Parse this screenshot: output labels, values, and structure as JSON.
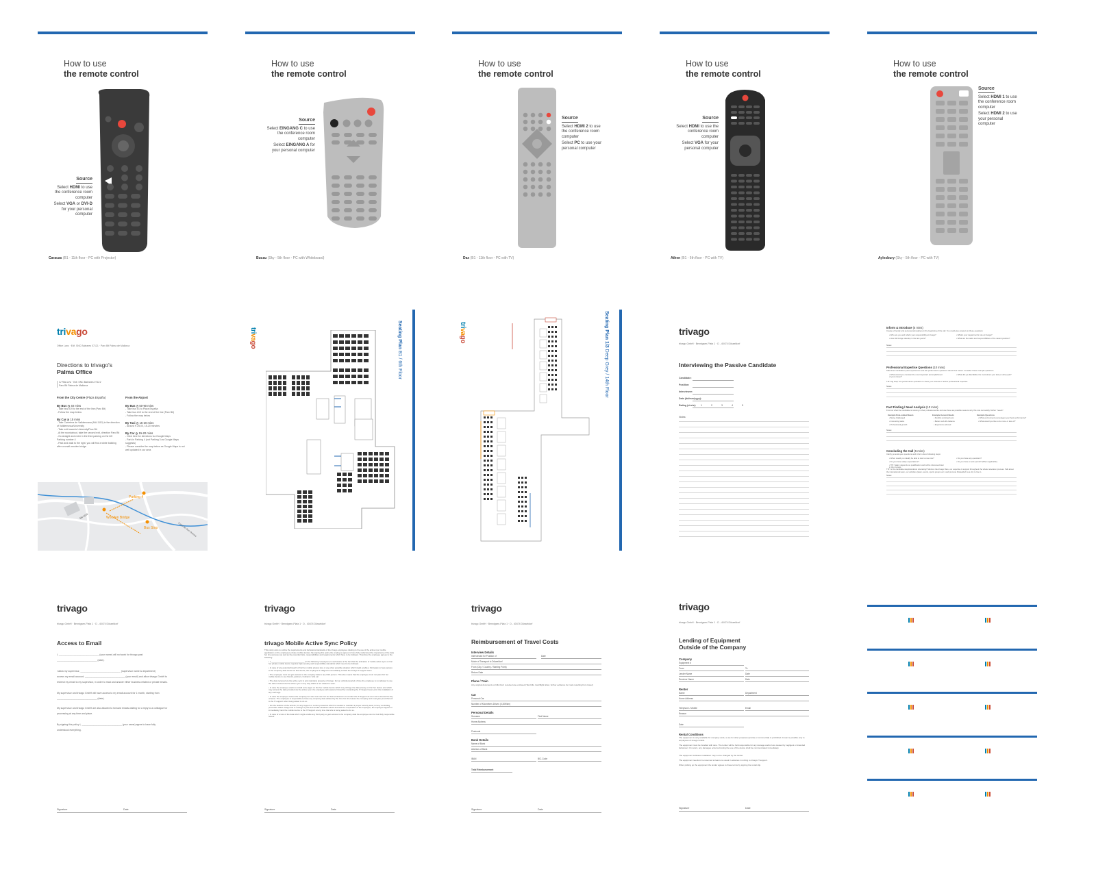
{
  "colors": {
    "blue": "#2267b0",
    "red": "#e8473c",
    "dark": "#3a3a3a",
    "gray": "#bdbdbd",
    "orange": "#f48f00",
    "teal": "#007fad"
  },
  "remote_title": {
    "line1": "How to use",
    "line2": "the remote control"
  },
  "remotes": [
    {
      "room": "Caracas",
      "floor": "(B1 - 11th floor - PC with Projector)",
      "source": "Source",
      "l1": "Select",
      "b1": "HDMI",
      "l2": "to use the conference room computer",
      "l3": "Select",
      "b2": "VGA",
      "l4": "or",
      "b3": "DVI-D",
      "l5": "for your personal computer"
    },
    {
      "room": "Bucau",
      "floor": "(Sky - 5th floor - PC with Whiteboard)",
      "source": "Source",
      "l1": "Select",
      "b1": "EINGANG C",
      "l2": "to use the conference room computer",
      "l3": "Select",
      "b2": "EINGANG A",
      "l4": "for your",
      "b3": "",
      "l5": "personal computer"
    },
    {
      "room": "Dax",
      "floor": "(B1 - 11th floor - PC with TV)",
      "source": "Source",
      "l1": "Select",
      "b1": "HDMI 2",
      "l2": "to use the conference room computer",
      "l3": "Select",
      "b2": "PC",
      "l4": "to use",
      "b3": "",
      "l5": "your personal computer"
    },
    {
      "room": "Athen",
      "floor": "(B1 - 6th floor - PC with TV)",
      "source": "Source",
      "l1": "Select",
      "b1": "HDMI",
      "l2": "to use the conference room computer",
      "l3": "Select",
      "b2": "VGA",
      "l4": "for your",
      "b3": "",
      "l5": "personal computer"
    },
    {
      "room": "Aylesbury",
      "floor": "(Sky - 5th floor - PC with TV)",
      "source": "Source",
      "l1": "Select",
      "b1": "HDMI 1",
      "l2": "to use the conference room computer",
      "l3": "Select",
      "b2": "HDMI 2",
      "l4": "to use your",
      "b3": "",
      "l5": "personal computer"
    }
  ],
  "brand": {
    "logo_a": "tri",
    "logo_b": "va",
    "logo_c": "go",
    "logo": "trivago"
  },
  "palma": {
    "address_top": "Office Lanc · Edf. SNC Baleares 07121 · Parc Bit Palma de Mallorca",
    "title1": "Directions to trivago's",
    "title2": "Palma Office",
    "addr_block": "C/ Rita Levi · Edf. SNC Baleares 07121 · Parc Bit Palma de Mallorca",
    "left_head": "From the City Centre",
    "left_head2": "(Plaza España)",
    "right_head": "From the Airport",
    "bus": "By Bus",
    "bus_time": "40 mins",
    "car": "By Car",
    "car_time": "15 mins",
    "taxi": "By Taxi",
    "taxi_time": "15-20 mins",
    "car2_time": "15-20 mins",
    "bus2_time": "50-90 mins",
    "left_bus_lines": [
      "Take bus #19 to the end of the line (Parc Bit)",
      "Follow the map below"
    ],
    "left_car_lines": [
      "Take Carretera de Valldemossa (MA-1110) in the direction of Valldemossa/University",
      "Take exit towards University/Parc Bit",
      "At the roundabout, take the second exit, direction Parc Bit",
      "Go straight and enter in the third parking on the left Parking number 4",
      "Park and walk to the right, you will find a white building after a small wooden bridge"
    ],
    "right_bus_lines": [
      "Take bus #1 to Plaza España",
      "Take bus #19 to the end of the line (Parc Bit)",
      "Follow the map below"
    ],
    "right_taxi_lines": [
      "Around € 25,00, 15-20 minutes"
    ],
    "right_car_lines": [
      "Click here for directions via Google Maps",
      "Park in Parking 4 (not Parking 3 as Google Maps suggests)",
      "Please consider the map below as Google Maps is not well updated in our area"
    ],
    "map_labels": {
      "parking": "Parking 4",
      "bridge": "Wooden Bridge",
      "bus_stop": "Bus Stop",
      "street": "Camí de Son Termes",
      "road": "Ma-1110"
    }
  },
  "seating": [
    {
      "title": "Seating Plan",
      "sub": "B1 / 6th Floor"
    },
    {
      "title": "Seating Plan 1/3",
      "sub": "Deep Grey / 14th Floor"
    }
  ],
  "interview": {
    "address": "trivago GmbH · Bennigsen-Platz 1 · D - 40474 Düsseldorf",
    "title": "Interviewing the Passive Candidate",
    "fields": [
      "Candidate:",
      "Position:",
      "Interviewer:",
      "Date (dd/mm/yyyy):",
      "Rating (circle):"
    ],
    "rating": [
      "1",
      "2",
      "3",
      "4",
      "5"
    ],
    "notes": "Notes:"
  },
  "interview2": {
    "s1": "Inform & Introduce",
    "s1t": "(5 mins)",
    "s1d": "Create a friendly and personal atmosphere in the beginning of the call. You could give answers to these questions:",
    "s1a": [
      "Who are you and what's your responsibility at trivago?",
      "How did trivago develop in the last years?"
    ],
    "s1b": [
      "What's your department's role at trivago?",
      "What are the tasks and responsibilities of the vacant position?"
    ],
    "s2": "Professional Expertise Questions",
    "s2t": "(10 mins)",
    "s2d": "Talk about candidate's past experiences and ask performance questions about their career. Consider these example questions:",
    "s2a": [
      "What would you consider the most important accomplishment of your career?"
    ],
    "s2b": [
      "What did you like/dislike the most about your last (or other) job?"
    ],
    "s2tip": "TIP: Dig deep into performance questions to show your interest in his/her professional expertise.",
    "s3": "Fact Finding / Need Analysis",
    "s3t": "(10 mins)",
    "s3d": "Find out what the candidate is missing in their professional life and use these as possible reasons why this role can satisfy his/her \"needs\":",
    "s3h": [
      "Example Role-related Needs",
      "Example General Needs",
      "Example Questions"
    ],
    "s3c1": [
      "Being challenged",
      "Interesting tasks",
      "Professional growth"
    ],
    "s3c2": [
      "Flexible working hours",
      "Better work-life balance",
      "Experience abroad"
    ],
    "s3c3": [
      "What environment encourages your best performance?",
      "What would you like to do more or less of?"
    ],
    "s4": "Concluding the Call",
    "s4t": "(5 mins)",
    "s4d": "Clarify general open questions and inform about following steps:",
    "s4a": [
      "When would you ideally be able to start a new role?",
      "Do you have salary expectations?",
      "TIP: Salary depends on qualification and will be discussed later in the process"
    ],
    "s4b": [
      "Do you have any questions?",
      "Do you have a work permit? (When applicable)"
    ],
    "s4tip": "TIP: Is the candidate skeptical about relocating? Mention the trivago Relo, our expertise & support throughout the whole relocation process. Talk about the international team, our activities (team events, sports groups etc.) and promote Düsseldorf as a city to live in.",
    "notes": "Notes:"
  },
  "forms": [
    {
      "title": "Access to Email",
      "lines": [
        "I, ______________________________ (your name) will not work for trivago past",
        "______________________________ (date).",
        "I allow my supervisor, ______________________________ (supervisor name & department)",
        "access my email account, ______________________________ (your email) and allow trivago GmbH to",
        "redirect my email to my supervisor, in order to read and answer either business related or private emails.",
        "My supervisor and trivago GmbH will have access to my email account for 1 month, starting from",
        "______________________________ (date).",
        "My supervisor and trivago GmbH are also allowed to forward emails waiting for a reply to a colleague for",
        "processing at any time and place.",
        "By signing this policy I, ______________________________ (your name) agree to have fully",
        "understood everything."
      ],
      "sig": "Signature",
      "date": "Date"
    },
    {
      "title": "trivago Mobile Active Sync Policy",
      "lines": [
        "This policy aims to outline the requirements and behavioral standards of the trivago employees relating to the use of the active sync mobile application on the employees private mobile devices. By signing this policy the employee agrees to have fully understood the importance of the data he/ she accesses as well as the potential risks, responsibilities and requirements which have to be followed. Therefore the employee agrees to the following:",
        "I, ______________________________ (in the following \"employee\") is well aware of the fact that the activation of mobile active sync on his/ her private mobile device requires high security and responsibility standards which need to be followed.",
        "In case of any potential breach of his/ her mobile privacy loss or any other possible situation which might enable a third party to have access to the company data stored on this device, the employee is obliged to immediately contact the trivago IT-support team.",
        "The employee must not give access to the company data to any third person. This also means that the employee must not pass his/ her mobile device to any friends, partners, husband / wife etc.",
        "The data received via the active sync is and maintains property of trivago. For an unlimited period of time the employee is not allowed to use the data received via the active sync in any way which is not related to work.",
        "In case the employee wants to install some apps on his/ her mobile device which may infringe the data privacy on his/ her device and which may access the data provided via the active sync, the employee will reassure himself by contacting the IT-Support team prior the installation of any such app.",
        "In case the employee leaves the company he/ she must use his/ her best endeavours to contact the IT-Support as soon as he knows his day of leave. The employee is responsible to have any company data deleted by the time he/ she leaves the company and must give proof thereof to the IT-support when being asked to do so.",
        "For the deletion of the access, for any support or control procedure which is needed to maintain a proper security level, for any controlling procedure which trivago has to undergo by law and similar situations which demand the cooperation of the employee, the employee agrees to immediately hand the mobile device to the IT-Support at any time that she is being asked to do so.",
        "In case of a loss of the data which might enable any third party to gain access to the company data the employee can be held fully responsible hereof."
      ],
      "sig": "Signature",
      "date": "Date"
    },
    {
      "title": "Reimbursement of Travel Costs",
      "s_interview": "Interview Details",
      "f_interview": [
        "Interviewed for Position of",
        "Mode of Transport to Düsseldorf",
        "From (City / Country / Starting Point)",
        "Return Date"
      ],
      "date": "Date",
      "s_plane": "Plane / Train",
      "plane_text": "Any original documents or bills that I received are enclosed (Taxi bills, train/flight ticket, further evidence for costs resulting from travel)",
      "s_car": "Car",
      "f_car": [
        "Personal Car",
        "Number of Kilometres Driven (0,30€/km)"
      ],
      "s_personal": "Personal Details",
      "f_personal": [
        "Surname",
        "First Name",
        "Home Address",
        "Postcode"
      ],
      "s_bank": "Bank Details",
      "f_bank": [
        "Name of Bank",
        "Address of Bank",
        "IBAN",
        "BIC-Code"
      ],
      "total": "Total Reimbursement",
      "sig": "Signature"
    },
    {
      "title1": "Lending of Equipment",
      "title2": "Outside of the Company",
      "s_company": "Company",
      "f_company": [
        "Equipment #",
        "From",
        "To",
        "Lender Name",
        "Date",
        "Receiver Name",
        "Date"
      ],
      "s_renter": "Renter",
      "f_renter": [
        "Name",
        "Department",
        "Home Address",
        "Telephone / Mobile",
        "Email",
        "Reason",
        "Date"
      ],
      "s_rental": "Rental Conditions",
      "rental_lines": [
        "The equipment is only available for company work, a use for other purposes (private or commercial) is prohibited. A loan is possible only to employees of trivago GmbH.",
        "The equipment must be handled with care. The lender will be held responsible for any damage and/or loss caused by negligent or intended behaviour. On return, any damages occurred during the use of the device shall be communicated immediately.",
        "The equipment software installation may not be changed by the lender.",
        "The equipment needs to be reserved at least one week in advance in writing to trivago IT-support.",
        "When picking up the equipment the lender agrees to these terms by signing the rental slip."
      ],
      "sig": "Signature",
      "date": "Date"
    }
  ]
}
